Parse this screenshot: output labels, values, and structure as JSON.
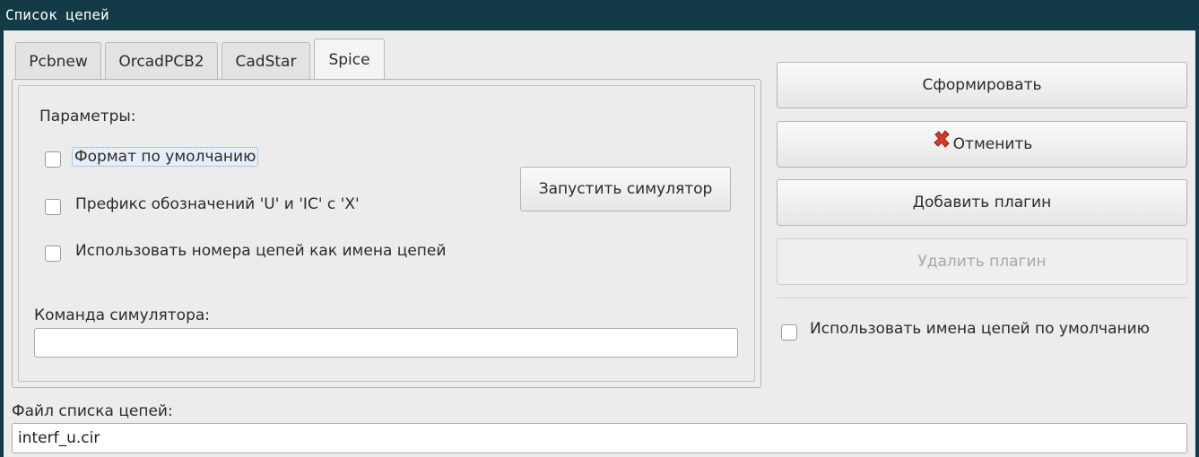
{
  "window": {
    "title": "Список цепей"
  },
  "tabs": [
    {
      "label": "Pcbnew"
    },
    {
      "label": "OrcadPCB2"
    },
    {
      "label": "CadStar"
    },
    {
      "label": "Spice"
    }
  ],
  "spice": {
    "params_heading": "Параметры:",
    "options": [
      {
        "label": "Формат по умолчанию",
        "checked": false
      },
      {
        "label": "Префикс обозначений 'U' и 'IC' с 'X'",
        "checked": false
      },
      {
        "label": "Использовать номера цепей  как имена цепей",
        "checked": false
      }
    ],
    "run_simulator_label": "Запустить симулятор",
    "sim_command_label": "Команда симулятора:",
    "sim_command_value": ""
  },
  "actions": {
    "generate_label": "Сформировать",
    "cancel_label": "Отменить",
    "add_plugin_label": "Добавить плагин",
    "remove_plugin_label": "Удалить плагин",
    "default_names_label": "Использовать имена цепей по умолчанию"
  },
  "netlist_file": {
    "label": "Файл списка цепей:",
    "value": "interf_u.cir"
  },
  "icons": {
    "cancel": "red-x-icon"
  },
  "colors": {
    "titlebar": "#133a47",
    "cancel_icon": "#d83a2a"
  }
}
